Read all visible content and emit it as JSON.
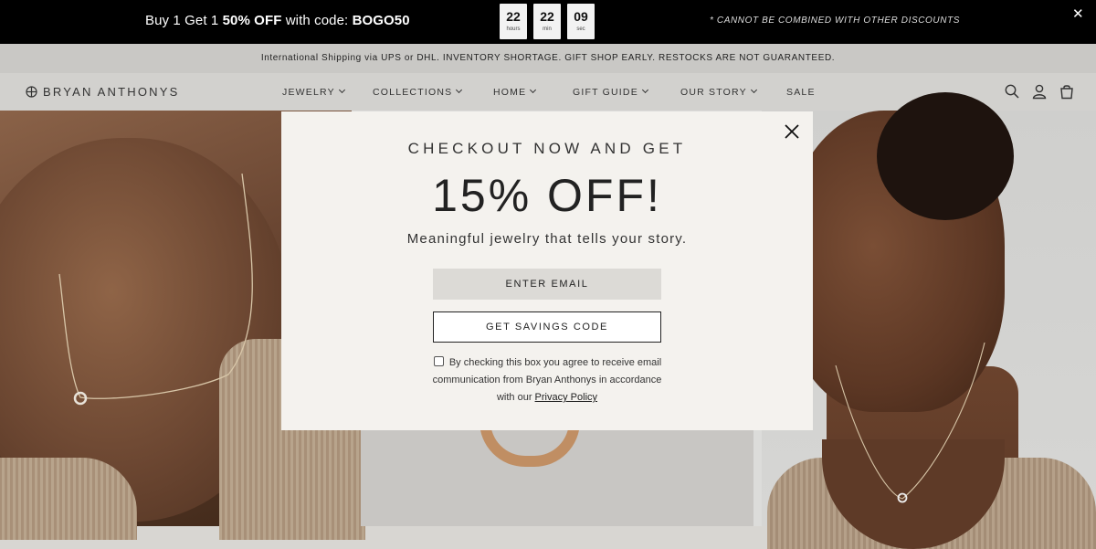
{
  "promo": {
    "prefix": "Buy 1 Get 1 ",
    "highlight": "50% OFF",
    "middle": " with code: ",
    "code": "BOGO50",
    "timer": [
      {
        "value": "22",
        "unit": "hours"
      },
      {
        "value": "22",
        "unit": "min"
      },
      {
        "value": "09",
        "unit": "sec"
      }
    ],
    "note": "* CANNOT BE COMBINED WITH OTHER DISCOUNTS",
    "close_symbol": "✕"
  },
  "shipping_bar": {
    "text": "International Shipping via UPS or DHL. INVENTORY SHORTAGE. GIFT SHOP EARLY. RESTOCKS ARE NOT GUARANTEED."
  },
  "nav": {
    "logo": "BRYAN ANTHONYS",
    "items": [
      {
        "label": "JEWELRY",
        "dropdown": true
      },
      {
        "label": "COLLECTIONS",
        "dropdown": true
      },
      {
        "label": "HOME",
        "dropdown": true
      },
      {
        "label": "GIFT GUIDE",
        "dropdown": true
      },
      {
        "label": "OUR STORY",
        "dropdown": true
      },
      {
        "label": "SALE",
        "dropdown": false
      }
    ],
    "icons": [
      "search-icon",
      "account-icon",
      "cart-icon"
    ]
  },
  "modal": {
    "kicker": "CHECKOUT NOW AND GET",
    "headline": "15% OFF!",
    "subtitle": "Meaningful jewelry that tells your story.",
    "email_placeholder": "ENTER EMAIL",
    "button_label": "GET SAVINGS CODE",
    "consent_text": "By checking this box you agree to receive email communication from Bryan Anthonys in accordance with our ",
    "privacy_link": "Privacy Policy",
    "consent_checked": false
  },
  "colors": {
    "promo_bg": "#000000",
    "ship_bar_bg": "#c9c8c5",
    "nav_bg": "#d2d1ce",
    "modal_bg": "#f4f2ee",
    "input_bg": "#dcdad6"
  }
}
